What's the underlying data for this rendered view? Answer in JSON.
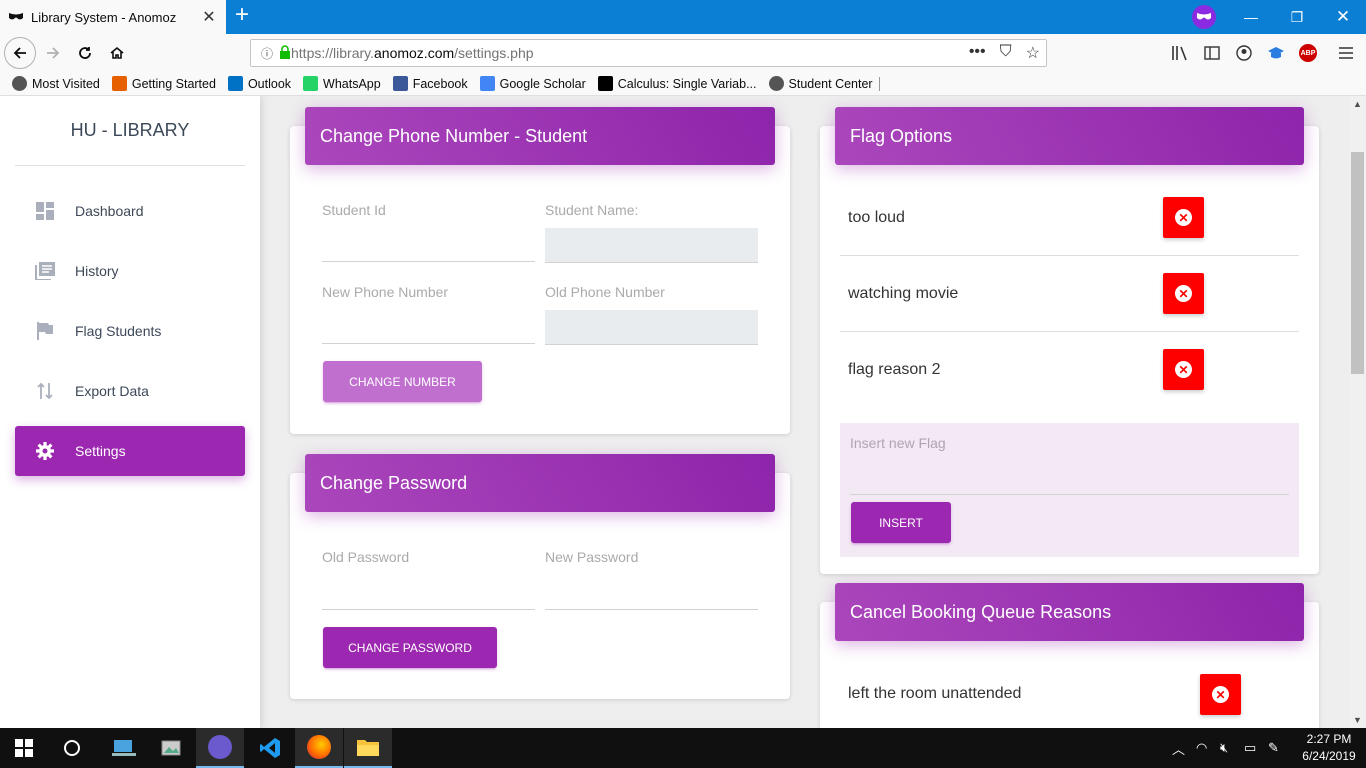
{
  "browser": {
    "tab_title": "Library System - Anomoz",
    "url_prefix": "https://library.",
    "url_domain": "anomoz.com",
    "url_path": "/settings.php",
    "bookmarks": [
      {
        "label": "Most Visited",
        "icon": "gear-icon",
        "color": "#555555"
      },
      {
        "label": "Getting Started",
        "icon": "firefox-icon",
        "color": "#e66000"
      },
      {
        "label": "Outlook",
        "icon": "outlook-icon",
        "color": "#0072c6"
      },
      {
        "label": "WhatsApp",
        "icon": "whatsapp-icon",
        "color": "#25d366"
      },
      {
        "label": "Facebook",
        "icon": "facebook-icon",
        "color": "#3b5998"
      },
      {
        "label": "Google Scholar",
        "icon": "scholar-icon",
        "color": "#4285f4"
      },
      {
        "label": "Calculus: Single Variab...",
        "icon": "calculus-icon",
        "color": "#000000"
      },
      {
        "label": "Student Center",
        "icon": "globe-icon",
        "color": "#555555"
      }
    ]
  },
  "sidebar": {
    "brand": "HU - LIBRARY",
    "items": [
      {
        "label": "Dashboard",
        "icon": "dashboard-icon"
      },
      {
        "label": "History",
        "icon": "history-icon"
      },
      {
        "label": "Flag Students",
        "icon": "flag-icon"
      },
      {
        "label": "Export Data",
        "icon": "export-icon"
      },
      {
        "label": "Settings",
        "icon": "settings-gear-icon",
        "active": true
      }
    ]
  },
  "phone_card": {
    "title": "Change Phone Number - Student",
    "student_id_label": "Student Id",
    "student_name_label": "Student Name:",
    "new_phone_label": "New Phone Number",
    "old_phone_label": "Old Phone Number",
    "button": "CHANGE NUMBER"
  },
  "password_card": {
    "title": "Change Password",
    "old_password_label": "Old Password",
    "new_password_label": "New Password",
    "button": "CHANGE PASSWORD"
  },
  "flag_card": {
    "title": "Flag Options",
    "items": [
      "too loud",
      "watching movie",
      "flag reason 2"
    ],
    "insert_placeholder": "Insert new Flag",
    "insert_button": "INSERT"
  },
  "cancel_card": {
    "title": "Cancel Booking Queue Reasons",
    "items": [
      "left the room unattended"
    ]
  },
  "taskbar": {
    "time": "2:27 PM",
    "date": "6/24/2019"
  },
  "colors": {
    "accent": "#9c27b0",
    "accent_light": "#c06fcf",
    "delete": "#ff0000",
    "insert_bg": "#f3e9f5"
  }
}
